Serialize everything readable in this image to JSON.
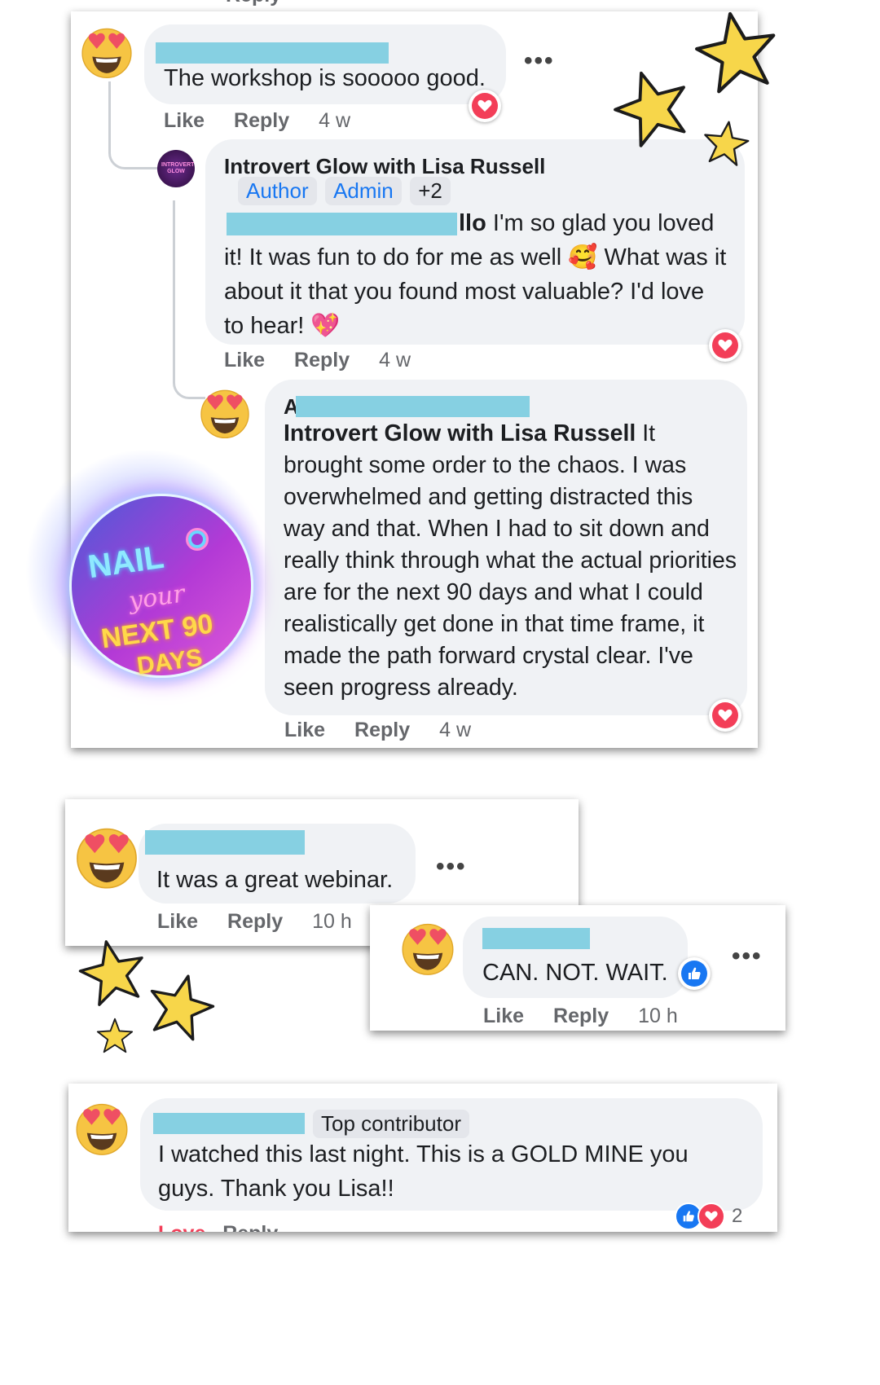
{
  "actions": {
    "like": "Like",
    "reply": "Reply"
  },
  "card1": {
    "comment1": {
      "text": "The workshop is sooooo good.",
      "time": "4 w"
    },
    "reply1": {
      "author": "Introvert Glow with Lisa Russell",
      "badges": [
        "Author",
        "Admin",
        "+2"
      ],
      "mention_tail": "llo",
      "text": "I'm so glad you loved it! It was fun to do for me as well 🥰 What was it about it that you found most valuable? I'd love to hear! 💖",
      "time": "4 w",
      "avatar_text": "INTROVERT GLOW"
    },
    "reply2": {
      "author_initial": "A",
      "mention": "Introvert Glow with Lisa Russell",
      "text": "It brought some order to the chaos. I was overwhelmed and getting distracted this way and that. When I had to sit down and really think through what the actual priorities are for the next 90 days and what I could realistically get done in that time frame, it made the path forward crystal clear. I've seen progress already.",
      "time": "4 w"
    }
  },
  "logo": {
    "line1": "NAIL",
    "line2": "your",
    "line3": "NEXT 90",
    "line4": "DAYS"
  },
  "card2": {
    "text": "It was a great webinar.",
    "time": "10 h"
  },
  "card3": {
    "text": "CAN. NOT. WAIT.",
    "time": "10 h"
  },
  "card4": {
    "badge": "Top contributor",
    "text": "I watched this last night. This is a GOLD MINE you guys. Thank you Lisa!!",
    "reaction_count": "2"
  },
  "colors": {
    "love": "#f33e58",
    "like": "#1877f2",
    "redaction": "#86d0e2",
    "star": "#f7d64a"
  }
}
